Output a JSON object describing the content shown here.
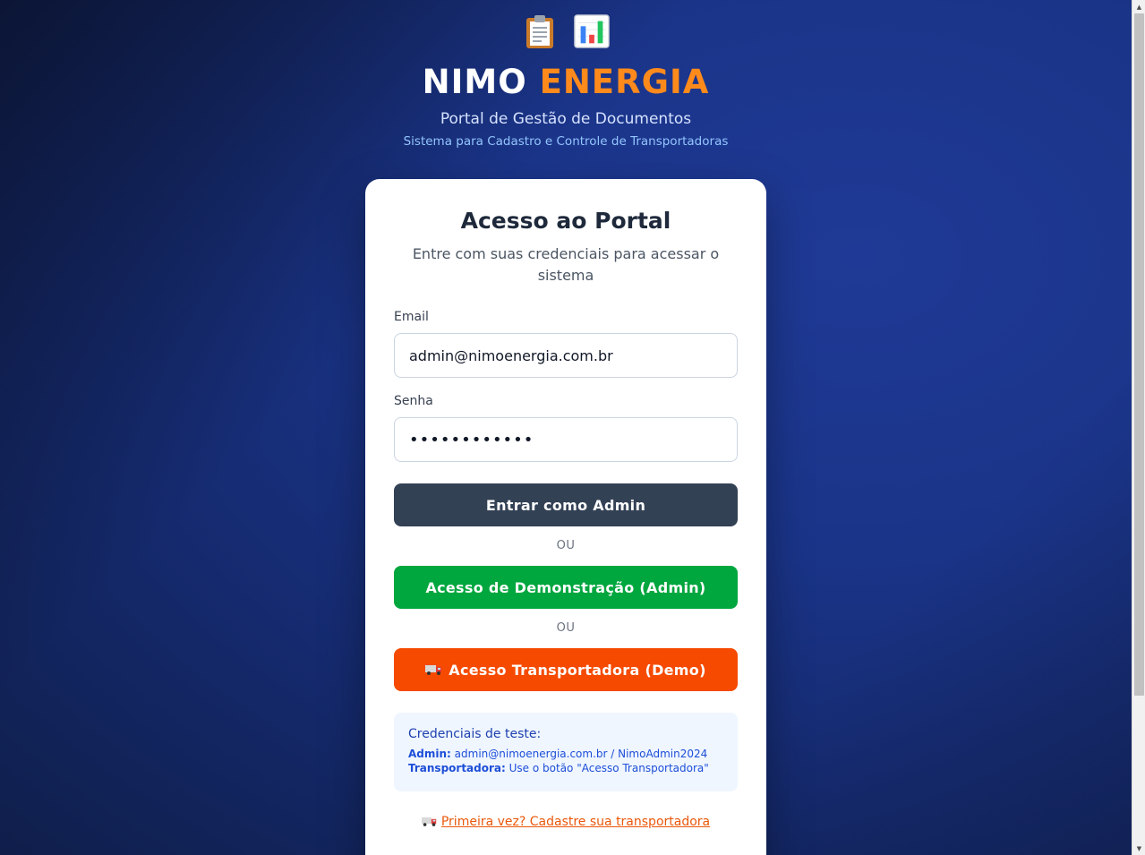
{
  "header": {
    "icons": [
      "clipboard-icon",
      "bar-chart-icon"
    ],
    "brand_primary": "NIMO",
    "brand_accent": "ENERGIA",
    "subtitle": "Portal de Gestão de Documentos",
    "tagline": "Sistema para Cadastro e Controle de Transportadoras"
  },
  "login": {
    "title": "Acesso ao Portal",
    "description": "Entre com suas credenciais para acessar o sistema",
    "email_label": "Email",
    "email_value": "admin@nimoenergia.com.br",
    "password_label": "Senha",
    "password_value": "••••••••••••",
    "admin_button": "Entrar como Admin",
    "separator_1": "OU",
    "demo_button": "Acesso de Demonstração (Admin)",
    "separator_2": "OU",
    "transport_button": "Acesso Transportadora (Demo)"
  },
  "test_credentials": {
    "title": "Credenciais de teste:",
    "admin_label": "Admin:",
    "admin_value": "admin@nimoenergia.com.br / NimoAdmin2024",
    "transport_label": "Transportadora:",
    "transport_value": "Use o botão \"Acesso Transportadora\""
  },
  "signup_link": "Primeira vez? Cadastre sua transportadora",
  "colors": {
    "brand_accent": "#ff8a1c",
    "admin_button": "#334155",
    "demo_button": "#00a63e",
    "transport_button": "#f54a00",
    "link": "#ea580c"
  }
}
